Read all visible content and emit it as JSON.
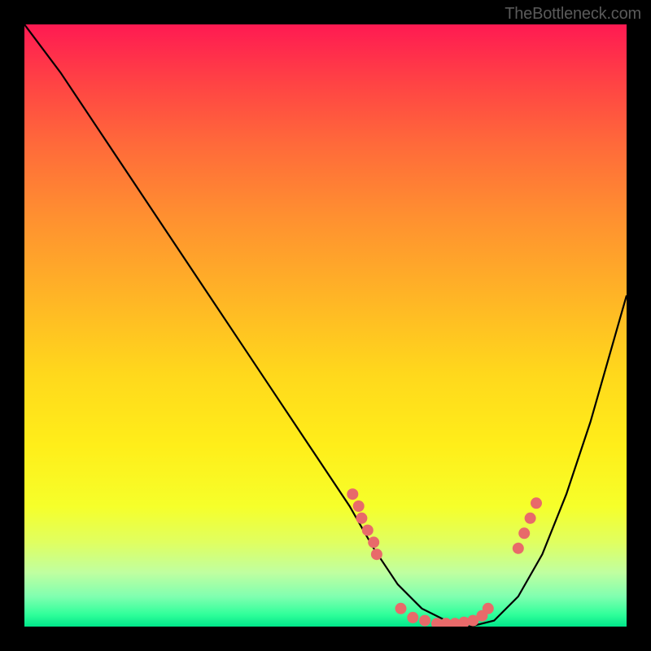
{
  "watermark": "TheBottleneck.com",
  "chart_data": {
    "type": "line",
    "title": "",
    "xlabel": "",
    "ylabel": "",
    "xlim": [
      0,
      100
    ],
    "ylim": [
      0,
      100
    ],
    "grid": false,
    "series": [
      {
        "name": "bottleneck-curve",
        "x": [
          0,
          6,
          12,
          18,
          24,
          30,
          36,
          42,
          48,
          54,
          58,
          62,
          66,
          70,
          74,
          78,
          82,
          86,
          90,
          94,
          98,
          100
        ],
        "y": [
          100,
          92,
          83,
          74,
          65,
          56,
          47,
          38,
          29,
          20,
          13,
          7,
          3,
          1,
          0,
          1,
          5,
          12,
          22,
          34,
          48,
          55
        ]
      }
    ],
    "points": {
      "name": "data-markers",
      "color": "#e86a6a",
      "x": [
        54.5,
        55.5,
        56.0,
        57.0,
        58.0,
        58.5,
        62.5,
        64.5,
        66.5,
        68.5,
        70.0,
        71.5,
        73.0,
        74.5,
        76.0,
        77.0,
        82.0,
        83.0,
        84.0,
        85.0
      ],
      "y": [
        22.0,
        20.0,
        18.0,
        16.0,
        14.0,
        12.0,
        3.0,
        1.5,
        1.0,
        0.5,
        0.5,
        0.5,
        0.7,
        1.0,
        1.8,
        3.0,
        13.0,
        15.5,
        18.0,
        20.5
      ]
    },
    "gradient_stops": [
      {
        "pos": 0,
        "color": "#ff1a52"
      },
      {
        "pos": 50,
        "color": "#ffd81c"
      },
      {
        "pos": 100,
        "color": "#00e68a"
      }
    ]
  }
}
